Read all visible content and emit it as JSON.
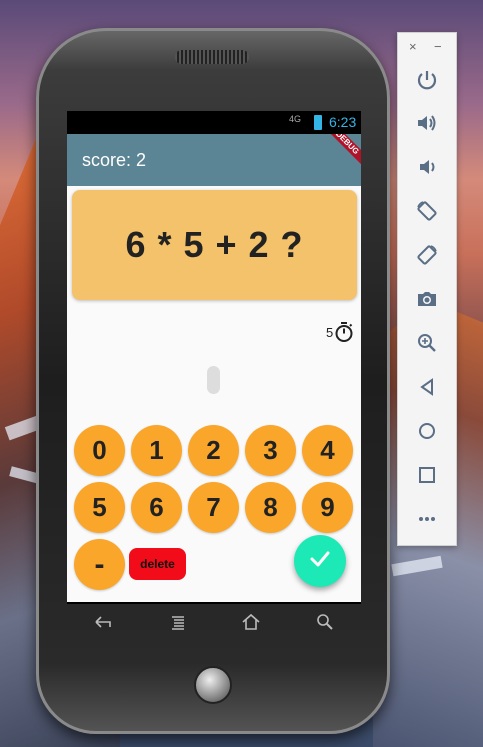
{
  "status_bar": {
    "network": "4G",
    "time": "6:23"
  },
  "app_bar": {
    "score_text": "score: 2",
    "debug_banner": "DEBUG"
  },
  "question": {
    "text": "6 * 5 + 2  ?"
  },
  "timer": {
    "seconds": "5",
    "icon": "stopwatch-icon"
  },
  "keypad": {
    "keys": [
      "0",
      "1",
      "2",
      "3",
      "4",
      "5",
      "6",
      "7",
      "8",
      "9"
    ],
    "minus_label": "-",
    "delete_label": "delete",
    "submit_icon": "check-icon"
  },
  "nav_bar": {
    "icons": [
      "back-icon",
      "menu-icon",
      "home-icon",
      "search-icon"
    ]
  },
  "emulator_toolbar": {
    "close_label": "×",
    "minimize_label": "−",
    "icons": [
      "power-icon",
      "volume-up-icon",
      "volume-down-icon",
      "rotate-left-icon",
      "rotate-right-icon",
      "camera-icon",
      "zoom-icon",
      "back-icon",
      "home-icon",
      "overview-icon",
      "more-icon"
    ]
  },
  "colors": {
    "app_bar": "#5b8594",
    "question_card": "#f4c26a",
    "keypad_key": "#f9a62b",
    "delete_button": "#f20c1a",
    "submit_fab": "#1de9b6",
    "status_accent": "#33b5e5"
  }
}
